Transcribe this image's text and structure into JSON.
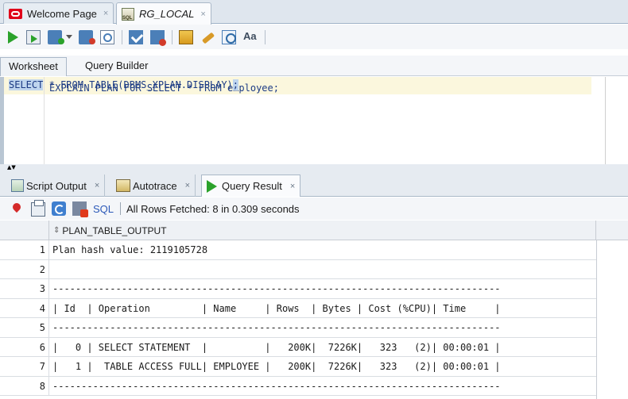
{
  "doc_tabs": [
    {
      "label": "Welcome Page",
      "icon": "oracle-icon",
      "close": "×"
    },
    {
      "label": "RG_LOCAL",
      "icon": "sql-worksheet-icon",
      "close": "×",
      "active": true
    }
  ],
  "toolbar": {
    "icons": [
      "run-statement-icon",
      "run-script-icon",
      "commit-icon",
      "dropdown-icon",
      "rollback-icon",
      "explain-plan-icon",
      "autotrace-icon",
      "autotrace-stop-icon",
      "sql-tuning-advisor-icon",
      "clear-icon",
      "sql-history-icon",
      "format-icon"
    ],
    "format_label": "Aa"
  },
  "sub_tabs": {
    "worksheet": "Worksheet",
    "query_builder": "Query Builder"
  },
  "editor": {
    "line1": "EXPLAIN PLAN FOR SELECT * FROM employee;",
    "line2_select": "SELECT",
    "line2_rest": " * FROM TABLE(DBMS_XPLAN.DISPLAY)",
    "line2_end": ";"
  },
  "splitter": {
    "arrows": "▲▼"
  },
  "bottom_tabs": [
    {
      "label": "Script Output",
      "close": "×"
    },
    {
      "label": "Autotrace",
      "close": "×"
    },
    {
      "label": "Query Result",
      "close": "×",
      "active": true
    }
  ],
  "result_toolbar": {
    "sql_link": "SQL",
    "status": "All Rows Fetched: 8 in 0.309 seconds"
  },
  "grid": {
    "column": "PLAN_TABLE_OUTPUT",
    "rows": [
      {
        "n": "1",
        "v": "Plan hash value: 2119105728"
      },
      {
        "n": "2",
        "v": ""
      },
      {
        "n": "3",
        "v": "------------------------------------------------------------------------------"
      },
      {
        "n": "4",
        "v": "| Id  | Operation         | Name     | Rows  | Bytes | Cost (%CPU)| Time     |"
      },
      {
        "n": "5",
        "v": "------------------------------------------------------------------------------"
      },
      {
        "n": "6",
        "v": "|   0 | SELECT STATEMENT  |          |   200K|  7226K|   323   (2)| 00:00:01 |"
      },
      {
        "n": "7",
        "v": "|   1 |  TABLE ACCESS FULL| EMPLOYEE |   200K|  7226K|   323   (2)| 00:00:01 |"
      },
      {
        "n": "8",
        "v": "------------------------------------------------------------------------------"
      }
    ]
  }
}
